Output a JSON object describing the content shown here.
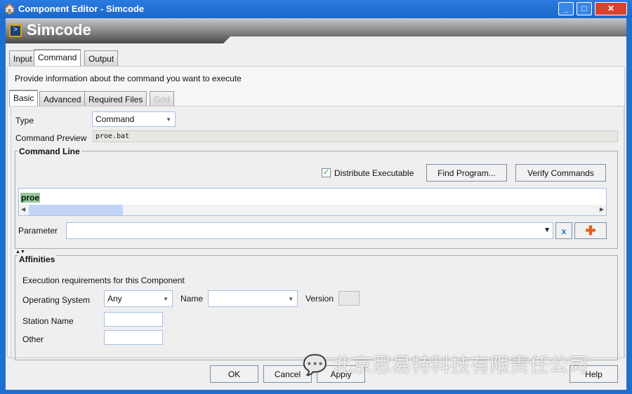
{
  "window": {
    "title": "Component Editor - Simcode",
    "minimize": "_",
    "maximize": "□",
    "close": "✕"
  },
  "banner": {
    "title": "Simcode"
  },
  "tabs": [
    {
      "label": "Input"
    },
    {
      "label": "Command"
    },
    {
      "label": "Output"
    }
  ],
  "description": "Provide information about the command you want to execute",
  "subtabs": [
    {
      "label": "Basic"
    },
    {
      "label": "Advanced"
    },
    {
      "label": "Required Files"
    },
    {
      "label": "Grid"
    }
  ],
  "type": {
    "label": "Type",
    "value": "Command"
  },
  "preview": {
    "label": "Command Preview",
    "value": "proe.bat"
  },
  "command_line": {
    "title": "Command Line",
    "distribute_label": "Distribute Executable",
    "distribute_checked": true,
    "find_program": "Find Program...",
    "verify_commands": "Verify Commands",
    "text": "proe",
    "parameter_label": "Parameter",
    "parameter_value": ""
  },
  "affinities": {
    "title": "Affinities",
    "requirements": "Execution requirements for this Component",
    "os_label": "Operating System",
    "os_value": "Any",
    "name_label": "Name",
    "name_value": "",
    "version_label": "Version",
    "version_value": "",
    "station_label": "Station Name",
    "station_value": "",
    "other_label": "Other",
    "other_value": ""
  },
  "buttons": {
    "ok": "OK",
    "cancel": "Cancel",
    "apply": "Apply",
    "help": "Help"
  },
  "watermark": "北京思易特科技有限责任公司"
}
